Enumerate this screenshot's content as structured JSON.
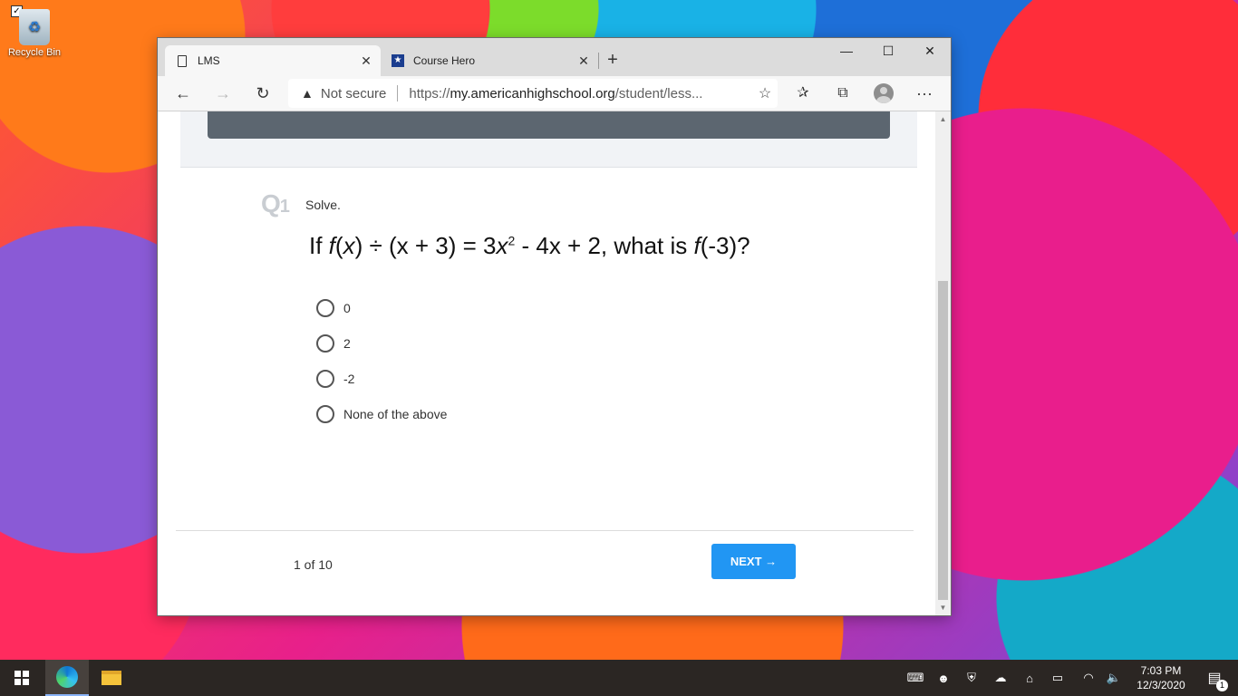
{
  "desktop": {
    "recycle_bin_label": "Recycle Bin"
  },
  "browser": {
    "tabs": [
      {
        "title": "LMS",
        "icon": "page-icon"
      },
      {
        "title": "Course Hero",
        "icon": "course-hero-icon"
      }
    ],
    "tab_close_glyph": "✕",
    "new_tab_glyph": "+",
    "window_controls": {
      "minimize": "—",
      "maximize": "☐",
      "close": "✕"
    },
    "nav": {
      "back": "←",
      "forward": "→",
      "refresh": "↻",
      "more": "···"
    },
    "address": {
      "warning_icon": "▲",
      "security_label": "Not secure",
      "url_prefix": "https://",
      "url_host": "my.americanhighschool.org",
      "url_path": "/student/less..."
    },
    "favorite_glyph": "☆",
    "favorites_glyph": "✰",
    "collections_glyph": "⧉"
  },
  "quiz": {
    "question_number_prefix": "Q",
    "question_number": "1",
    "instruction": "Solve.",
    "question": {
      "part1": "If ",
      "f1": "f",
      "part2": "(",
      "x1": "x",
      "part3": ") ÷ (x + 3) = 3",
      "x2": "x",
      "exp": "2",
      "part4": " - 4x + 2, what is ",
      "f2": "f",
      "part5": "(-3)?"
    },
    "choices": [
      "0",
      "2",
      "-2",
      "None of the above"
    ],
    "page_count": "1 of 10",
    "next_label": "NEXT",
    "next_arrow": "→"
  },
  "scrollbar": {
    "up": "▲",
    "down": "▼"
  },
  "taskbar": {
    "time": "7:03 PM",
    "date": "12/3/2020",
    "notification_count": "1",
    "tray_glyphs": [
      "⌨",
      "☻",
      "⛨",
      "☁",
      "⌂",
      "▭",
      "◠",
      "🔈"
    ]
  }
}
